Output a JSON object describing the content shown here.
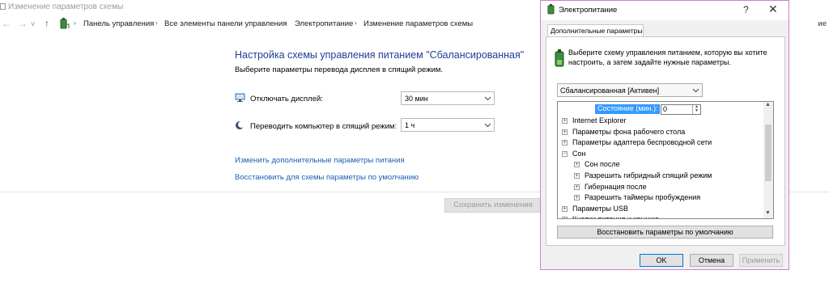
{
  "window": {
    "title": "Изменение параметров схемы"
  },
  "breadcrumb": {
    "items": [
      "Панель управления",
      "Все элементы панели управления",
      "Электропитание",
      "Изменение параметров схемы"
    ],
    "right_hint": "ие"
  },
  "main": {
    "heading": "Настройка схемы управления питанием \"Сбалансированная\"",
    "subheading": "Выберите параметры перевода дисплея в спящий режим.",
    "display_label": "Отключать дисплей:",
    "display_value": "30 мин",
    "sleep_label": "Переводить компьютер в спящий режим:",
    "sleep_value": "1 ч",
    "link_advanced": "Изменить дополнительные параметры питания",
    "link_restore": "Восстановить для схемы параметры по умолчанию",
    "save_button": "Сохранить изменения"
  },
  "dialog": {
    "title": "Электропитание",
    "help": "?",
    "close": "✕",
    "tab": "Дополнительные параметры",
    "description": "Выберите схему управления питанием, которую вы хотите настроить, а затем задайте нужные параметры.",
    "scheme_value": "Сбалансированная [Активен]",
    "state_label": "Состояние (мин.):",
    "state_value": "0",
    "tree": [
      {
        "label": "Internet Explorer",
        "level": 0,
        "sign": "+"
      },
      {
        "label": "Параметры фона рабочего стола",
        "level": 0,
        "sign": "+"
      },
      {
        "label": "Параметры адаптера беспроводной сети",
        "level": 0,
        "sign": "+"
      },
      {
        "label": "Сон",
        "level": 0,
        "sign": "−"
      },
      {
        "label": "Сон после",
        "level": 1,
        "sign": "+"
      },
      {
        "label": "Разрешить гибридный спящий режим",
        "level": 1,
        "sign": "+"
      },
      {
        "label": "Гибернация после",
        "level": 1,
        "sign": "+"
      },
      {
        "label": "Разрешить таймеры пробуждения",
        "level": 1,
        "sign": "+"
      },
      {
        "label": "Параметры USB",
        "level": 0,
        "sign": "+"
      },
      {
        "label": "Кнопки питания и крышка",
        "level": 0,
        "sign": "+"
      }
    ],
    "restore_button": "Восстановить параметры по умолчанию",
    "ok_button": "OK",
    "cancel_button": "Отмена",
    "apply_button": "Применить"
  },
  "colors": {
    "heading": "#1e3d96",
    "link": "#1c5fb0",
    "dialog_border": "#d47dcf",
    "selection": "#3399ff"
  },
  "icons": [
    "power-options-icon",
    "arrow-back-icon",
    "arrow-forward-icon",
    "arrow-up-icon",
    "chevron-down-icon",
    "monitor-icon",
    "moon-icon",
    "battery-plug-icon"
  ]
}
